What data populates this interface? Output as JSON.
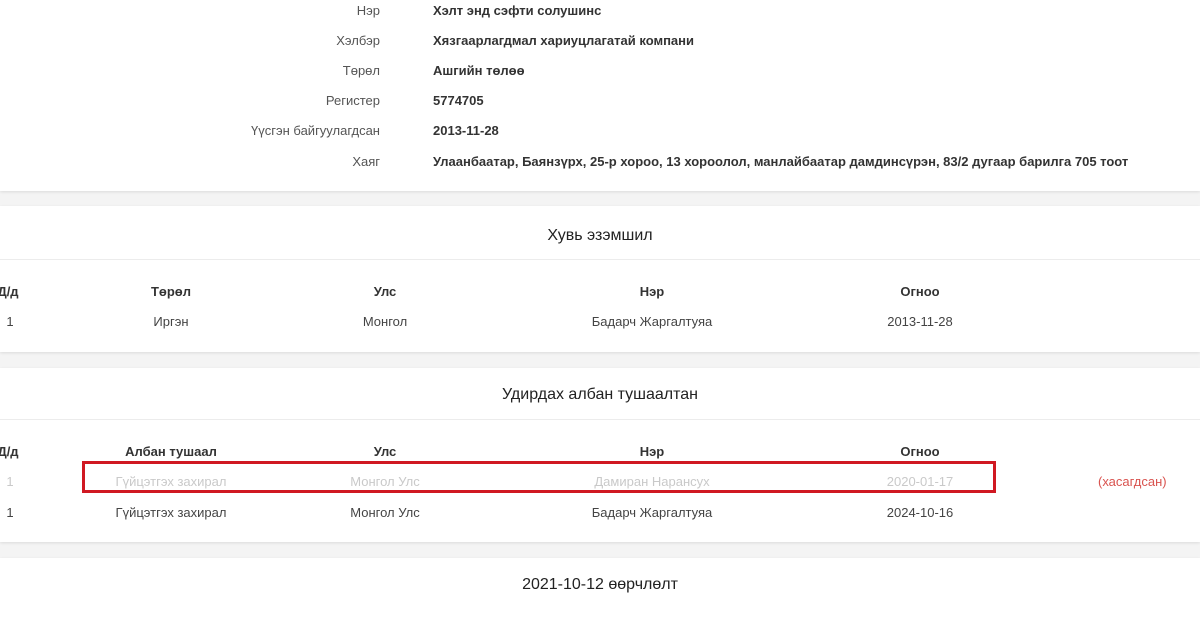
{
  "company": {
    "rows": [
      {
        "label": "Нэр",
        "value": "Хэлт энд сэфти солушинс"
      },
      {
        "label": "Хэлбэр",
        "value": "Хязгаарлагдмал хариуцлагатай компани"
      },
      {
        "label": "Төрөл",
        "value": "Ашгийн төлөө"
      },
      {
        "label": "Регистер",
        "value": "5774705"
      },
      {
        "label": "Үүсгэн байгуулагдсан",
        "value": "2013-11-28"
      },
      {
        "label": "Хаяг",
        "value": "Улаанбаатар, Баянзүрх, 25-р хороо, 13 хороолол, манлайбаатар дамдинсүрэн, 83/2 дугаар барилга 705 тоот"
      }
    ]
  },
  "ownership": {
    "title": "Хувь эзэмшил",
    "headers": [
      "Д/д",
      "Төрөл",
      "Улс",
      "Нэр",
      "Огноо"
    ],
    "rows": [
      [
        "1",
        "Иргэн",
        "Монгол",
        "Бадарч Жаргалтуяа",
        "2013-11-28"
      ]
    ]
  },
  "officials": {
    "title": "Удирдах албан тушаалтан",
    "headers": [
      "Д/д",
      "Албан тушаал",
      "Улс",
      "Нэр",
      "Огноо"
    ],
    "rows": [
      [
        "1",
        "Гүйцэтгэх захирал",
        "Монгол Улс",
        "Дамиран Нарансух",
        "2020-01-17"
      ],
      [
        "1",
        "Гүйцэтгэх захирал",
        "Монгол Улс",
        "Бадарч Жаргалтуяа",
        "2024-10-16"
      ]
    ],
    "removed_label": "(хасагдсан)"
  },
  "change": {
    "title": "2021-10-12 өөрчлөлт"
  },
  "colors": {
    "highlight": "#d01822",
    "removed": "#d9534f"
  }
}
